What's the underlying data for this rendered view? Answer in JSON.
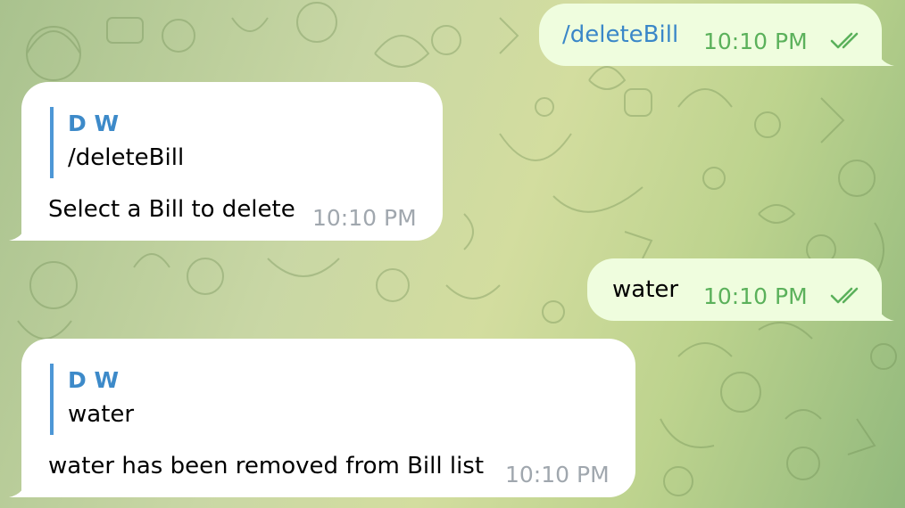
{
  "theme": {
    "outgoing_bubble": "#effdde",
    "incoming_bubble": "#ffffff",
    "outgoing_time_color": "#5bb15b",
    "incoming_time_color": "#a0a7ae",
    "reply_accent": "#4d97d6",
    "command_link_color": "#3a87c8"
  },
  "messages": [
    {
      "direction": "outgoing",
      "text": "/deleteBill",
      "time": "10:10 PM",
      "status_icon": "double-check-icon"
    },
    {
      "direction": "incoming",
      "reply_to": {
        "sender": "D W",
        "text": "/deleteBill"
      },
      "text": "Select a Bill to delete",
      "time": "10:10 PM"
    },
    {
      "direction": "outgoing",
      "text": "water",
      "time": "10:10 PM",
      "status_icon": "double-check-icon"
    },
    {
      "direction": "incoming",
      "reply_to": {
        "sender": "D W",
        "text": "water"
      },
      "text": "water has been removed from Bill list",
      "time": "10:10 PM"
    }
  ]
}
